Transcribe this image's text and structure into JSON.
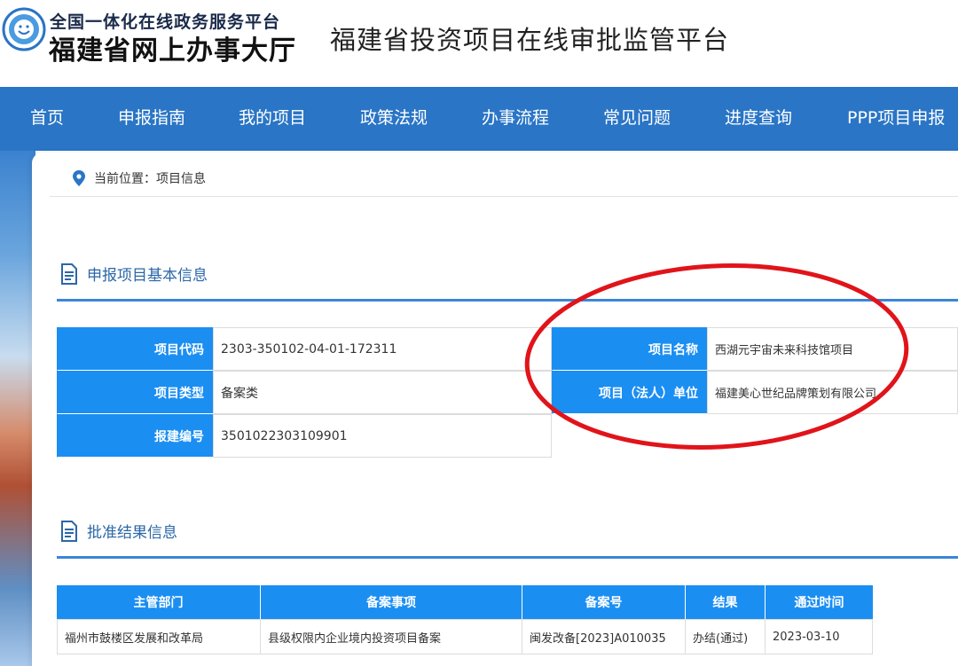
{
  "header": {
    "portal_top": "全国一体化在线政务服务平台",
    "portal_main": "福建省网上办事大厅",
    "platform_title": "福建省投资项目在线审批监管平台"
  },
  "nav": {
    "items": [
      "首页",
      "申报指南",
      "我的项目",
      "政策法规",
      "办事流程",
      "常见问题",
      "进度查询",
      "PPP项目申报"
    ]
  },
  "breadcrumb": {
    "text": "当前位置：项目信息"
  },
  "basic_info": {
    "title": "申报项目基本信息",
    "rows": [
      {
        "label": "项目代码",
        "value": "2303-350102-04-01-172311"
      },
      {
        "label": "项目类型",
        "value": "备案类"
      },
      {
        "label": "报建编号",
        "value": "3501022303109901"
      }
    ],
    "right_rows": [
      {
        "label": "项目名称",
        "value": "西湖元宇宙未来科技馆项目"
      },
      {
        "label": "项目（法人）单位",
        "value": "福建美心世纪品牌策划有限公司"
      }
    ]
  },
  "result_info": {
    "title": "批准结果信息",
    "headers": [
      "主管部门",
      "备案事项",
      "备案号",
      "结果",
      "通过时间"
    ],
    "row": [
      "福州市鼓楼区发展和改革局",
      "县级权限内企业境内投资项目备案",
      "闽发改备[2023]A010035",
      "办结(通过)",
      "2023-03-10"
    ]
  },
  "colors": {
    "nav_bg": "#2a75c6",
    "label_bg": "#1b8ef2",
    "annotation": "#e0141a"
  }
}
